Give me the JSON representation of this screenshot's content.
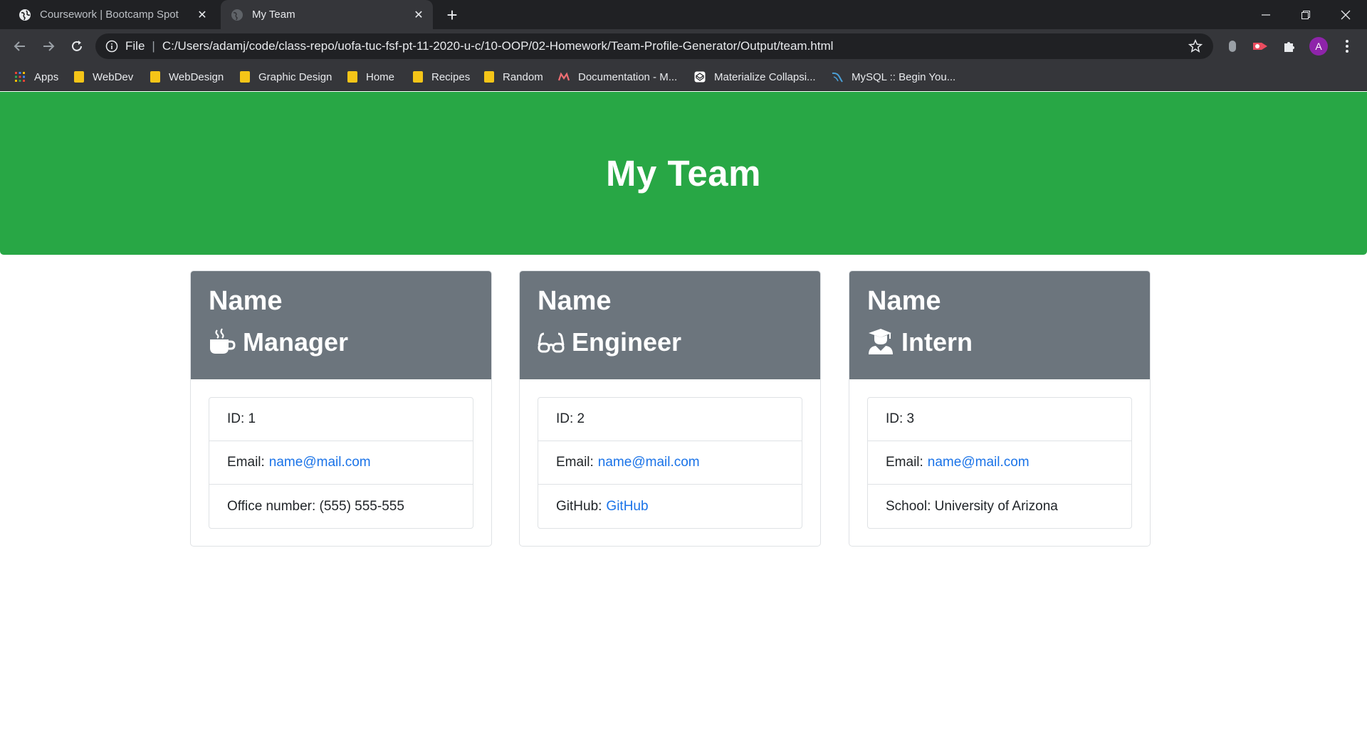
{
  "browser": {
    "tabs": [
      {
        "title": "Coursework | Bootcamp Spot",
        "active": false
      },
      {
        "title": "My Team",
        "active": true
      }
    ],
    "address": {
      "scheme": "File",
      "url": "C:/Users/adamj/code/class-repo/uofa-tuc-fsf-pt-11-2020-u-c/10-OOP/02-Homework/Team-Profile-Generator/Output/team.html"
    },
    "profile_initial": "A",
    "bookmarks": [
      {
        "label": "Apps",
        "icon": "apps-grid-icon"
      },
      {
        "label": "WebDev",
        "icon": "folder-icon"
      },
      {
        "label": "WebDesign",
        "icon": "folder-icon"
      },
      {
        "label": "Graphic Design",
        "icon": "folder-icon"
      },
      {
        "label": "Home",
        "icon": "folder-icon"
      },
      {
        "label": "Recipes",
        "icon": "folder-icon"
      },
      {
        "label": "Random",
        "icon": "folder-icon"
      },
      {
        "label": "Documentation - M...",
        "icon": "materialize-icon"
      },
      {
        "label": "Materialize Collapsi...",
        "icon": "codepen-icon"
      },
      {
        "label": "MySQL :: Begin You...",
        "icon": "mysql-icon"
      }
    ]
  },
  "page": {
    "title": "My Team",
    "colors": {
      "header": "#28a745",
      "card_header": "#6c757d",
      "link": "#1a73e8"
    },
    "members": [
      {
        "name": "Name",
        "role": "Manager",
        "icon": "coffee-mug-icon",
        "id_label": "ID: 1",
        "email_label": "Email:",
        "email": "name@mail.com",
        "extra_label": "Office number: (555) 555-555",
        "extra_link": ""
      },
      {
        "name": "Name",
        "role": "Engineer",
        "icon": "glasses-icon",
        "id_label": "ID: 2",
        "email_label": "Email:",
        "email": "name@mail.com",
        "extra_label": "GitHub:",
        "extra_link": "GitHub"
      },
      {
        "name": "Name",
        "role": "Intern",
        "icon": "graduate-icon",
        "id_label": "ID: 3",
        "email_label": "Email:",
        "email": "name@mail.com",
        "extra_label": "School: University of Arizona",
        "extra_link": ""
      }
    ]
  }
}
